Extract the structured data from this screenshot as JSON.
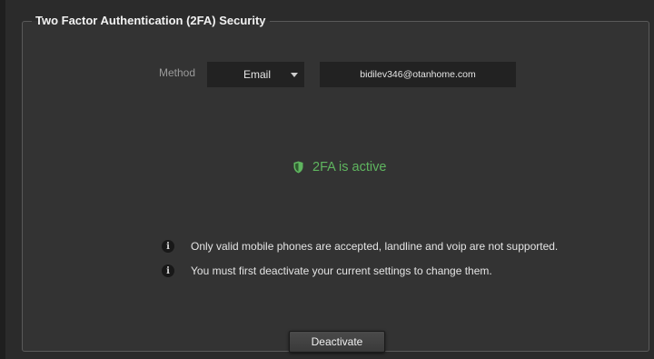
{
  "panel": {
    "title": "Two Factor Authentication (2FA) Security"
  },
  "method": {
    "label": "Method",
    "selected": "Email"
  },
  "email": {
    "value": "bidilev346@otanhome.com"
  },
  "status": {
    "text": "2FA is active",
    "icon": "shield-icon",
    "color": "#5fb55f"
  },
  "notes": [
    {
      "icon": "info-icon",
      "text": "Only valid mobile phones are accepted, landline and voip are not supported."
    },
    {
      "icon": "info-icon",
      "text": "You must first deactivate your current settings to change them."
    }
  ],
  "actions": {
    "deactivate_label": "Deactivate"
  }
}
